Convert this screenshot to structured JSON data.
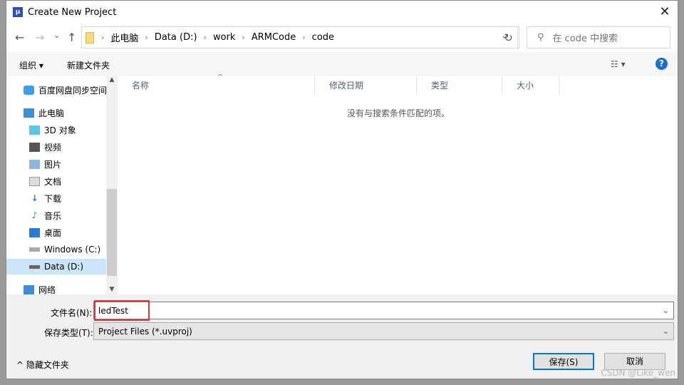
{
  "window": {
    "title": "Create New Project",
    "close": "✕"
  },
  "nav": {
    "back": "←",
    "forward": "→",
    "recent": "⌄",
    "up": "↑",
    "breadcrumb": [
      "此电脑",
      "Data (D:)",
      "work",
      "ARMCode",
      "code"
    ],
    "refresh": "↻",
    "search_placeholder": "在 code 中搜索",
    "search_icon": "⚲"
  },
  "toolbar": {
    "organize": "组织 ▾",
    "new_folder": "新建文件夹",
    "view": "☷ ▾",
    "help": "?"
  },
  "sidebar": {
    "items": [
      "百度网盘同步空间",
      "此电脑",
      "3D 对象",
      "视频",
      "图片",
      "文档",
      "下载",
      "音乐",
      "桌面",
      "Windows (C:)",
      "Data (D:)",
      "网络"
    ],
    "selected": "Data (D:)"
  },
  "columns": [
    "名称",
    "修改日期",
    "类型",
    "大小"
  ],
  "empty_message": "没有与搜索条件匹配的项。",
  "form": {
    "filename_label": "文件名(N):",
    "filename_value": "ledTest",
    "filetype_label": "保存类型(T):",
    "filetype_value": "Project Files (*.uvproj)"
  },
  "buttons": {
    "save": "保存(S)",
    "cancel": "取消",
    "hide_folders": "^ 隐藏文件夹"
  },
  "watermark": "CSDN @Like_wen",
  "colors": {
    "accent": "#0078d7",
    "highlight": "#e53333",
    "selected": "#cce4f7"
  }
}
